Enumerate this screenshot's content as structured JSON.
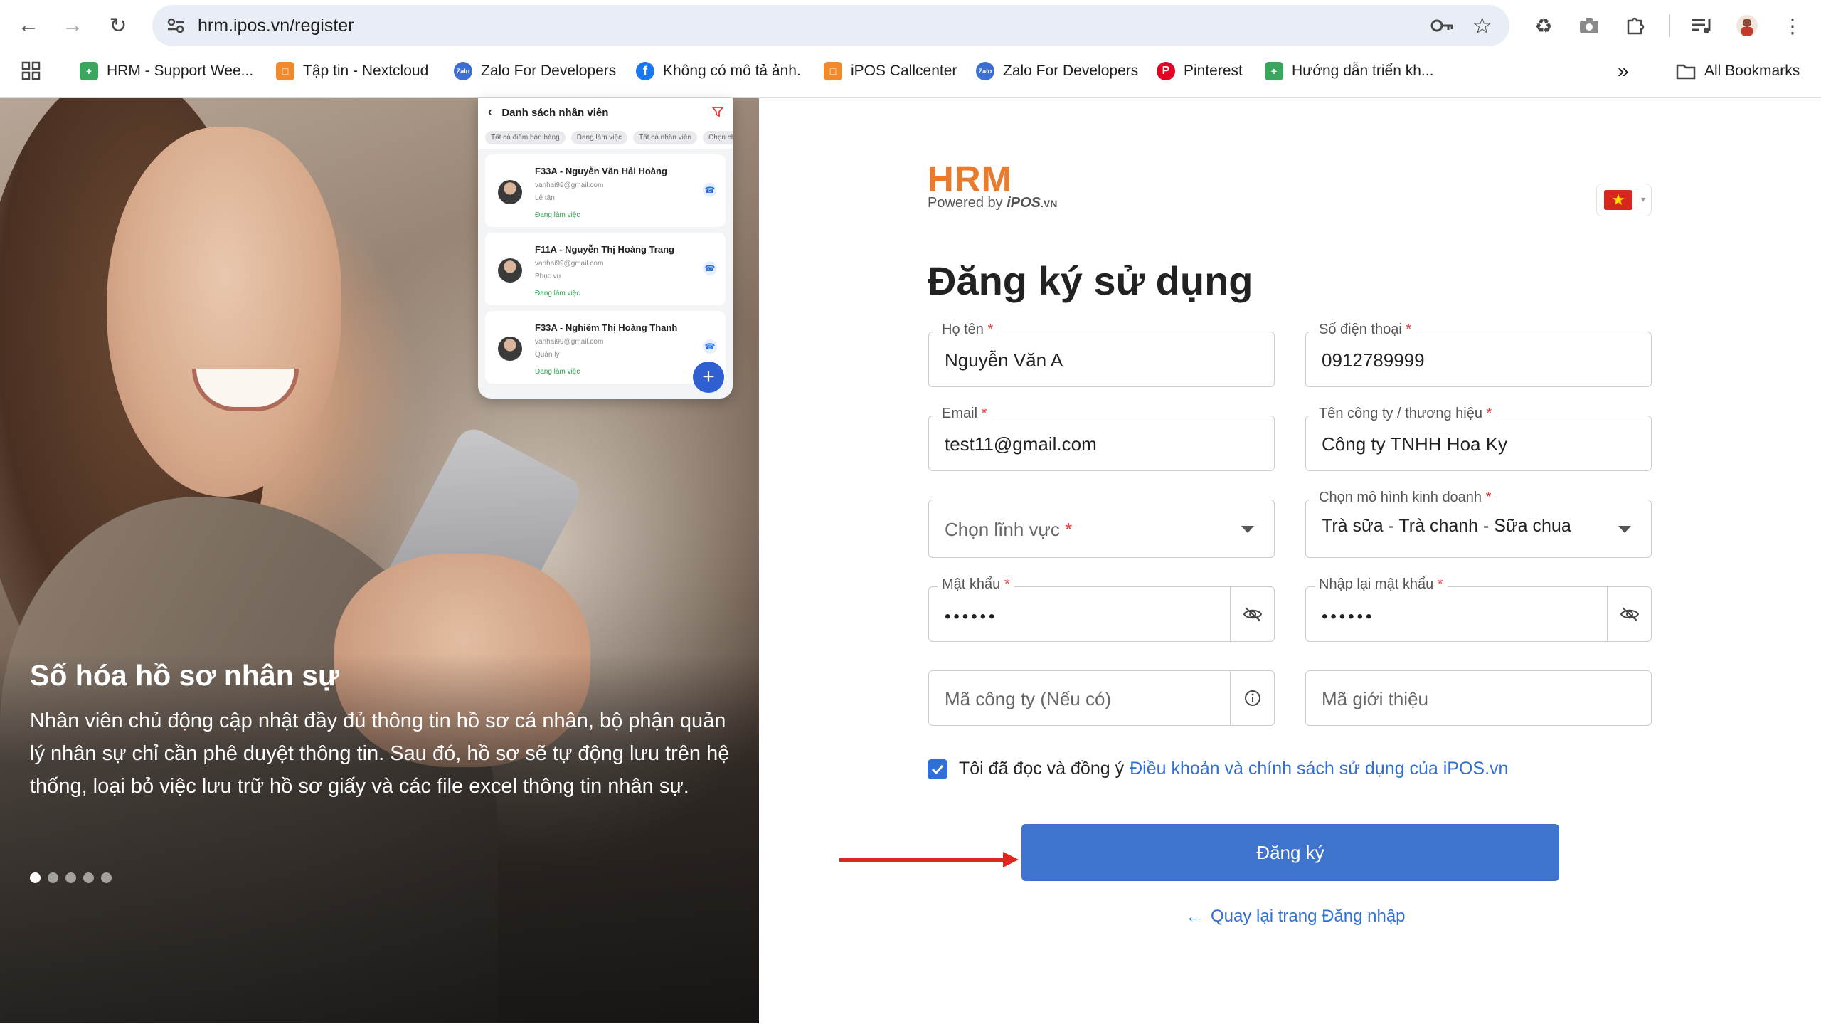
{
  "browser": {
    "url": "hrm.ipos.vn/register",
    "bookmarks": [
      {
        "label": "HRM - Support Wee...",
        "icon": "green-cross-icon",
        "color": "#3aa55d"
      },
      {
        "label": "Tập tin - Nextcloud",
        "icon": "orange-square-icon",
        "color": "#f08a2c"
      },
      {
        "label": "Zalo For Developers",
        "icon": "zalo-icon",
        "color": "#3b6fd6"
      },
      {
        "label": "Không có mô tả ảnh.",
        "icon": "facebook-icon",
        "color": "#1877f2"
      },
      {
        "label": "iPOS Callcenter",
        "icon": "orange-square-icon",
        "color": "#f08a2c"
      },
      {
        "label": "Zalo For Developers",
        "icon": "zalo-icon",
        "color": "#3b6fd6"
      },
      {
        "label": "Pinterest",
        "icon": "pinterest-icon",
        "color": "#e60023"
      },
      {
        "label": "Hướng dẫn triển kh...",
        "icon": "green-cross-icon",
        "color": "#3aa55d"
      }
    ],
    "all_bookmarks": "All Bookmarks",
    "overflow": "»"
  },
  "hero": {
    "title": "Số hóa hồ sơ nhân sự",
    "description": "Nhân viên chủ động cập nhật đầy đủ thông tin hồ sơ cá nhân, bộ phận quản lý nhân sự chỉ cần phê duyệt thông tin. Sau đó, hồ sơ sẽ tự động lưu trên hệ thống, loại bỏ việc lưu trữ hồ sơ giấy và các file excel thông tin nhân sự.",
    "slide_count": 5,
    "active_slide": 1
  },
  "mockup": {
    "title": "Danh sách nhân viên",
    "chips": [
      "Tất cả điểm bán hàng",
      "Đang làm việc",
      "Tất cả nhân viên",
      "Chọn chứ"
    ],
    "employees": [
      {
        "name": "F33A - Nguyễn Văn Hải Hoàng",
        "email": "vanhai99@gmail.com",
        "role": "Lễ tân",
        "status": "Đang làm việc"
      },
      {
        "name": "F11A - Nguyễn Thị Hoàng Trang",
        "email": "vanhai99@gmail.com",
        "role": "Phục vụ",
        "status": "Đang làm việc"
      },
      {
        "name": "F33A - Nghiêm Thị Hoàng Thanh",
        "email": "vanhai99@gmail.com",
        "role": "Quản lý",
        "status": "Đang làm việc"
      }
    ],
    "fab": "+"
  },
  "brand": {
    "logo": "HRM",
    "powered_by": "Powered by",
    "powered_name": "iPOS",
    "powered_suffix": ".VN",
    "accent": "#e87b2e"
  },
  "language": {
    "flag": "vietnam-flag-icon",
    "star": "★"
  },
  "form": {
    "title": "Đăng ký sử dụng",
    "full_name": {
      "label": "Họ tên",
      "value": "Nguyễn Văn A"
    },
    "phone": {
      "label": "Số điện thoại",
      "value": "0912789999"
    },
    "email": {
      "label": "Email",
      "value": "test11@gmail.com"
    },
    "company": {
      "label": "Tên công ty / thương hiệu",
      "value": "Công ty TNHH Hoa Ky"
    },
    "field_select": {
      "placeholder": "Chọn lĩnh vực"
    },
    "business_model": {
      "label": "Chọn mô hình kinh doanh",
      "value": "Trà sữa - Trà chanh - Sữa chua"
    },
    "password": {
      "label": "Mật khẩu",
      "value": "••••••"
    },
    "confirm_password": {
      "label": "Nhập lại mật khẩu",
      "value": "••••••"
    },
    "company_code": {
      "placeholder": "Mã công ty (Nếu có)"
    },
    "referral_code": {
      "placeholder": "Mã giới thiệu"
    },
    "required_mark": "*",
    "agree_text": "Tôi đã đọc và đồng ý",
    "agree_link": "Điều khoản và chính sách sử dụng của iPOS.vn",
    "agree_checked": true,
    "submit_label": "Đăng ký",
    "back_link": "Quay lại trang Đăng nhập",
    "primary_color": "#3f74cc"
  }
}
